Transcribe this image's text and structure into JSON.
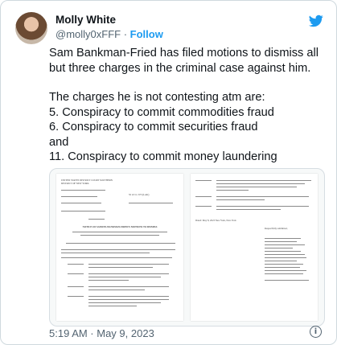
{
  "author": {
    "name": "Molly White",
    "handle": "@molly0xFFF",
    "separator": " · ",
    "follow_label": "Follow",
    "avatar_icon": "avatar-photo"
  },
  "tweet": {
    "paragraph1": "Sam Bankman-Fried has filed motions to dismiss all but three charges in the criminal case against him.",
    "paragraph2": "The charges he is not contesting atm are:\n5. Conspiracy to commit commodities fraud\n6. Conspiracy to commit securities fraud\nand\n11. Conspiracy to commit money laundering",
    "timestamp": "5:19 AM · May 9, 2023"
  },
  "document": {
    "caption": "NOTICE OF SAMUEL BANKMAN-FRIED'S MOTIONS TO DISMISS",
    "court": "UNITED STATES DISTRICT COURT SOUTHERN DISTRICT OF NEW YORK",
    "case": "S5 22 Cr. 673 (LAK)",
    "dated": "Dated: May 8, 2023 New York, New York",
    "signoff": "Respectfully submitted,"
  },
  "icons": {
    "brand": "twitter-bird-icon",
    "info": "info-icon"
  },
  "colors": {
    "accent": "#1d9bf0",
    "text": "#0f1419",
    "secondary": "#536471"
  }
}
